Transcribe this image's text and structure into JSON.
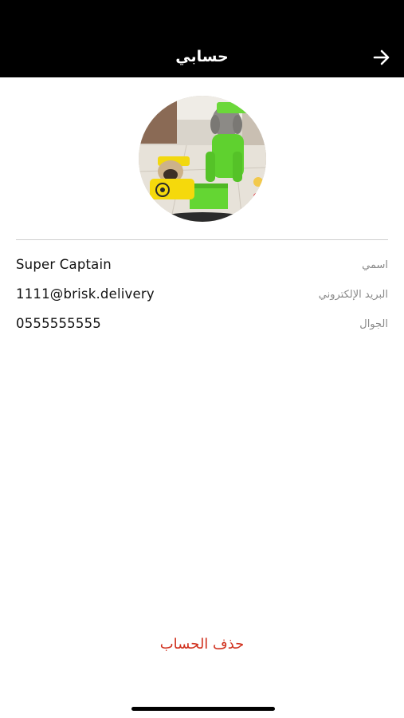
{
  "header": {
    "title": "حسابي",
    "back_icon": "arrow-right-icon"
  },
  "profile": {
    "avatar_icon": "avatar-photo"
  },
  "fields": [
    {
      "label": "اسمي",
      "value": "Super Captain"
    },
    {
      "label": "البريد الإلكتروني",
      "value": "1111@brisk.delivery"
    },
    {
      "label": "الجوال",
      "value": "0555555555"
    }
  ],
  "actions": {
    "delete_account": "حذف الحساب"
  },
  "colors": {
    "header_bg": "#000000",
    "delete_color": "#d0301d",
    "label_color": "#8a8a8a"
  }
}
